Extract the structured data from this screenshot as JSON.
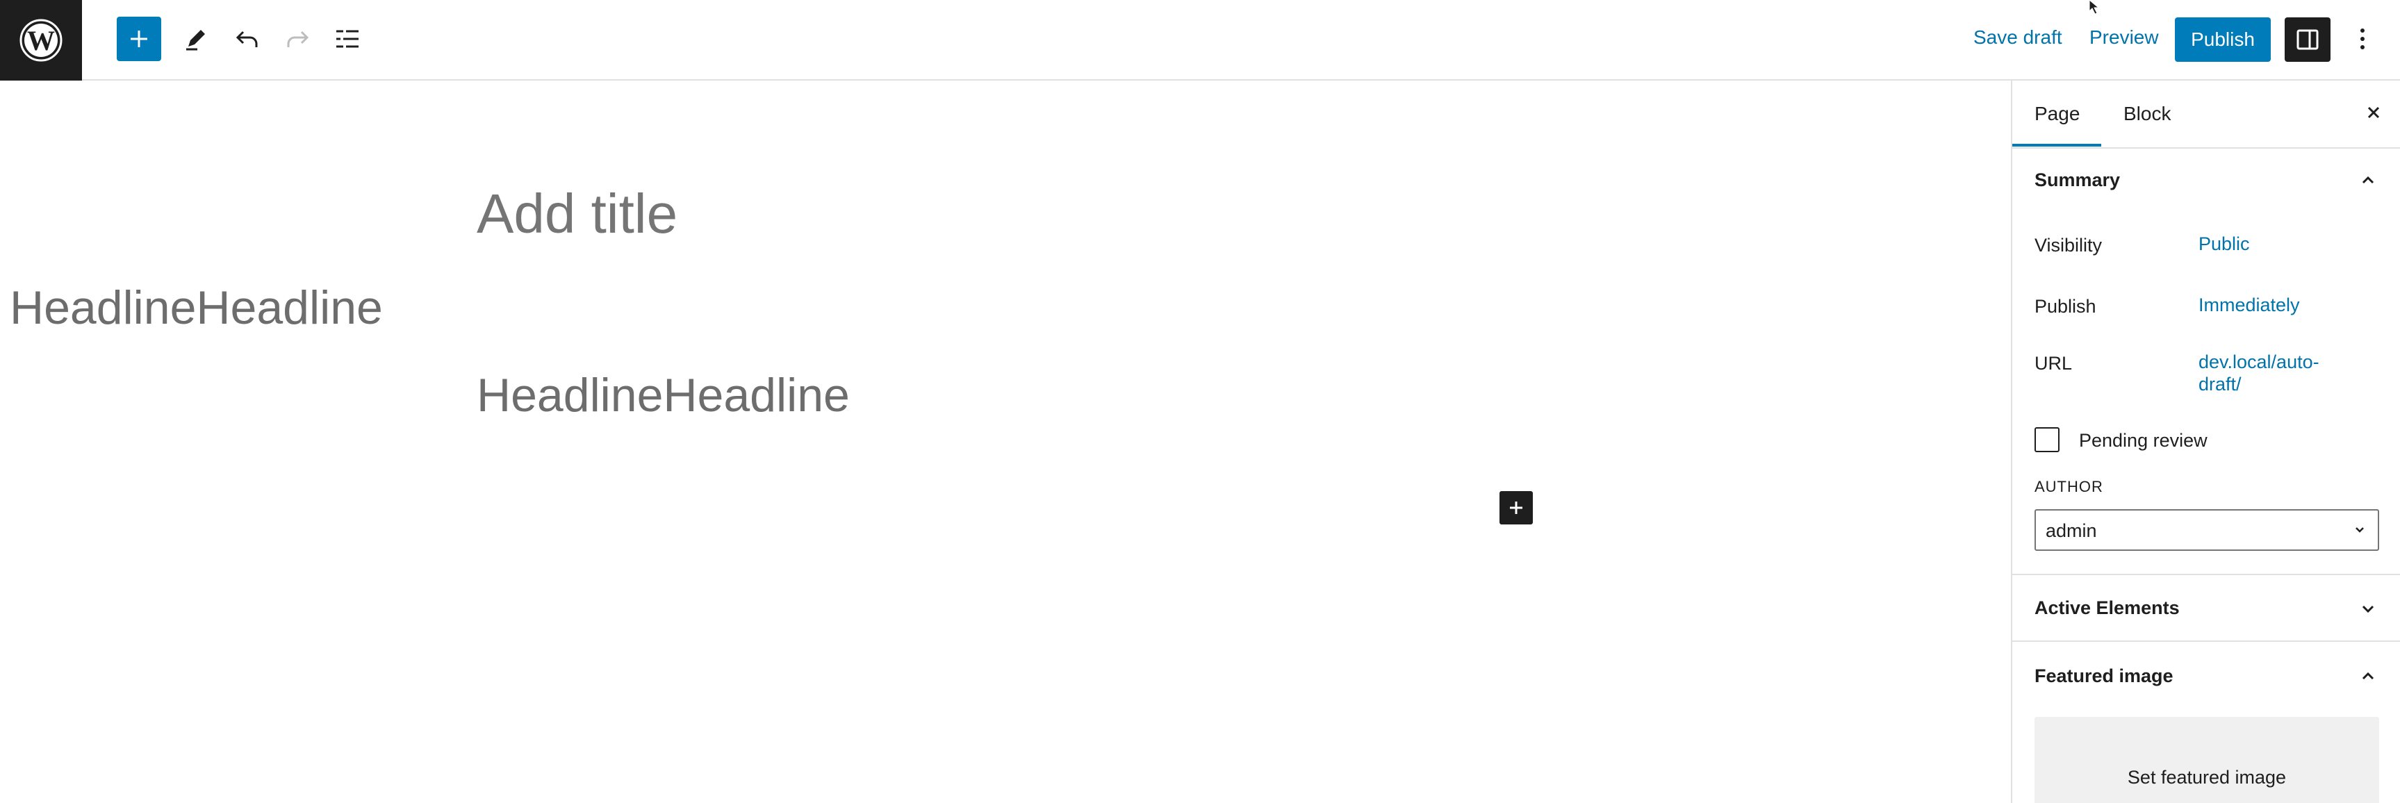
{
  "toolbar": {
    "save_draft": "Save draft",
    "preview": "Preview",
    "publish": "Publish"
  },
  "editor": {
    "title_placeholder": "Add title",
    "headline_side": "HeadlineHeadline",
    "headline_main": "HeadlineHeadline"
  },
  "sidebar": {
    "tabs": [
      {
        "label": "Page",
        "active": true
      },
      {
        "label": "Block",
        "active": false
      }
    ],
    "summary": {
      "title": "Summary",
      "visibility_label": "Visibility",
      "visibility_value": "Public",
      "publish_label": "Publish",
      "publish_value": "Immediately",
      "url_label": "URL",
      "url_value_line1": "dev.local/auto-",
      "url_value_line2": "draft/",
      "pending_review": "Pending review",
      "author_label": "AUTHOR",
      "author_value": "admin"
    },
    "active_elements": {
      "title": "Active Elements"
    },
    "featured_image": {
      "title": "Featured image",
      "set_label": "Set featured image"
    }
  },
  "colors": {
    "accent": "#007cba",
    "link": "#0073aa",
    "dark": "#1e1e1e",
    "border": "#e0e0e0",
    "placeholder": "#757575"
  },
  "icons": {
    "logo": "wordpress-logo-icon",
    "inserter": "plus-icon",
    "tools": "pencil-icon",
    "undo": "undo-icon",
    "redo": "redo-icon",
    "list_view": "list-view-icon",
    "settings": "sidebar-toggle-icon",
    "options": "vertical-ellipsis-icon",
    "close": "close-icon"
  }
}
